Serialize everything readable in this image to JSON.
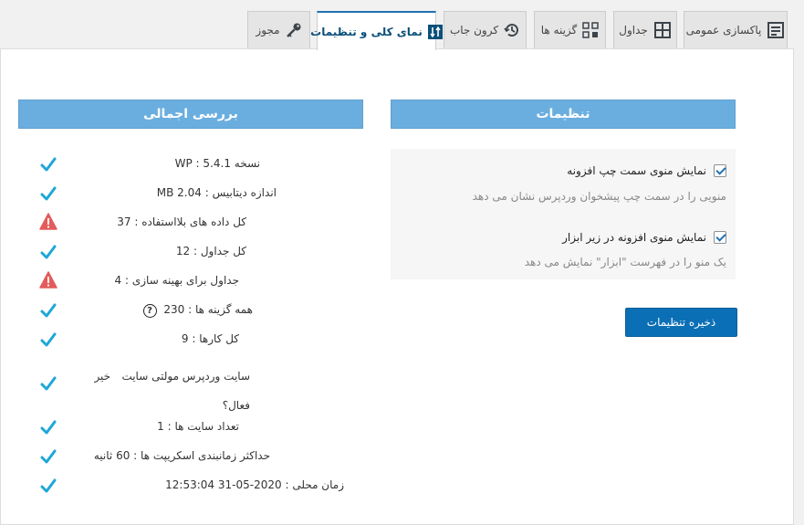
{
  "tabs": [
    {
      "label": "پاکسازی عمومی",
      "icon": "document-list-icon"
    },
    {
      "label": "جداول",
      "icon": "table-grid-icon"
    },
    {
      "label": "گزینه ها",
      "icon": "options-grid-icon"
    },
    {
      "label": "کرون جاب",
      "icon": "history-clock-icon"
    },
    {
      "label": "نمای کلی و تنظیمات",
      "icon": "sort-settings-icon",
      "active": true
    },
    {
      "label": "مجوز",
      "icon": "key-icon"
    }
  ],
  "settings": {
    "title": "تنظیمات",
    "options": [
      {
        "label": "نمایش منوی سمت چپ افزونه",
        "desc": "منویی را در سمت چپ پیشخوان وردپرس نشان می دهد",
        "checked": true
      },
      {
        "label": "نمایش منوی افزونه در زیر ابزار",
        "desc": "یک منو را در فهرست \"ابزار\" نمایش می دهد",
        "checked": true
      }
    ],
    "save_label": "ذخیره تنظیمات"
  },
  "overview": {
    "title": "بررسی اجمالی",
    "items": [
      {
        "text": "نسخه WP : 5.4.1",
        "status": "ok"
      },
      {
        "text": "اندازه دیتابیس : 2.04 MB",
        "status": "ok"
      },
      {
        "text": "کل داده های بلااستفاده : 37",
        "status": "warn"
      },
      {
        "text": "کل جداول : 12",
        "status": "ok"
      },
      {
        "text": "جداول برای بهینه سازی : 4",
        "status": "warn"
      },
      {
        "text": "همه گزینه ها : 230",
        "status": "ok",
        "help": "?"
      },
      {
        "text": "کل کارها : 9",
        "status": "ok"
      },
      {
        "text": "سایت وردپرس مولتی سایت فعال؟",
        "text_line1": "سایت وردپرس مولتی سایت",
        "text_line2": "فعال؟",
        "value": "خیر",
        "status": "ok"
      },
      {
        "text": "تعداد سایت ها : 1",
        "status": "ok"
      },
      {
        "text": "حداکثر زمانبندی اسکریپت ها : 60 ثانیه",
        "status": "ok"
      },
      {
        "text": "زمان محلی : 2020-05-31 12:53:04",
        "status": "ok"
      }
    ]
  },
  "colors": {
    "accent": "#6aaee0",
    "button": "#0b6fb5",
    "ok": "#1ea7d8",
    "warn": "#e35b5b"
  }
}
